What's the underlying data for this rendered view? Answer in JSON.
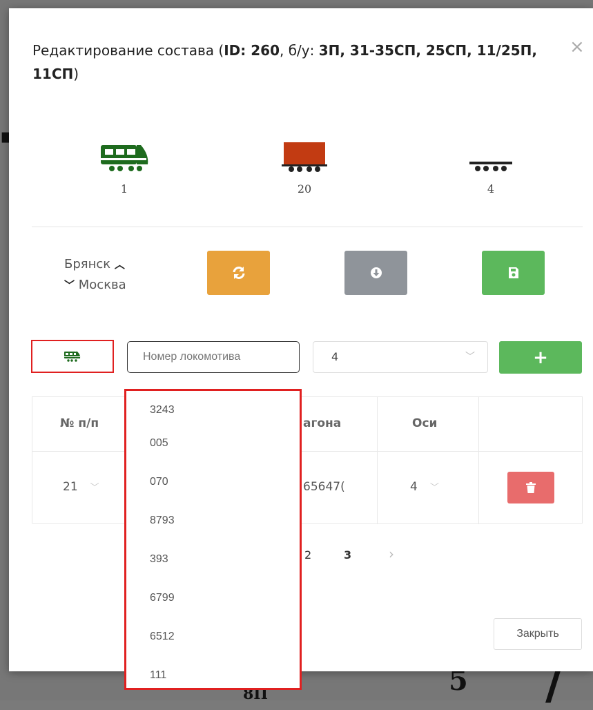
{
  "modal": {
    "title_prefix": "Редактирование состава (",
    "title_id": "ID: 260",
    "title_mid": ", б/у: ",
    "title_tail": "3П, 31-35СП, 25СП, 11/25П, 11СП",
    "title_close_paren": ")",
    "close_symbol": "×"
  },
  "summary": {
    "locomotives": {
      "count": "1",
      "icon": "locomotive-icon",
      "color": "#1e6b1e"
    },
    "wagons": {
      "count": "20",
      "icon": "freight-wagon-icon",
      "color": "#c23b12"
    },
    "platforms": {
      "count": "4",
      "icon": "flatcar-icon",
      "color": "#222222"
    }
  },
  "route": {
    "from": "Брянск",
    "to": "Москва",
    "up_icon": "chevron-up-icon",
    "down_icon": "chevron-down-icon"
  },
  "toolbar": {
    "refresh_icon": "refresh-icon",
    "download_icon": "download-icon",
    "save_icon": "save-icon",
    "colors": {
      "refresh": "#e8a23c",
      "download": "#8f949a",
      "save": "#5cb85c"
    }
  },
  "add_row": {
    "type_icon": "locomotive-icon",
    "number_placeholder": "Номер локомотива",
    "axles_value": "4",
    "add_label": "+"
  },
  "table": {
    "headers": {
      "seq": "№ п/п",
      "wagon": "агона",
      "axles": "Оси"
    },
    "rows": [
      {
        "seq": "21",
        "wagon": "65647(",
        "axles": "4"
      }
    ]
  },
  "pagination": {
    "page2": "2",
    "page3": "3",
    "next": "›"
  },
  "footer": {
    "close_label": "Закрыть"
  },
  "dropdown": {
    "options": [
      "3243",
      "005",
      "070",
      "8793",
      "393",
      "6799",
      "6512",
      "111"
    ]
  },
  "backdrop": {
    "bottom_text": "8П"
  }
}
